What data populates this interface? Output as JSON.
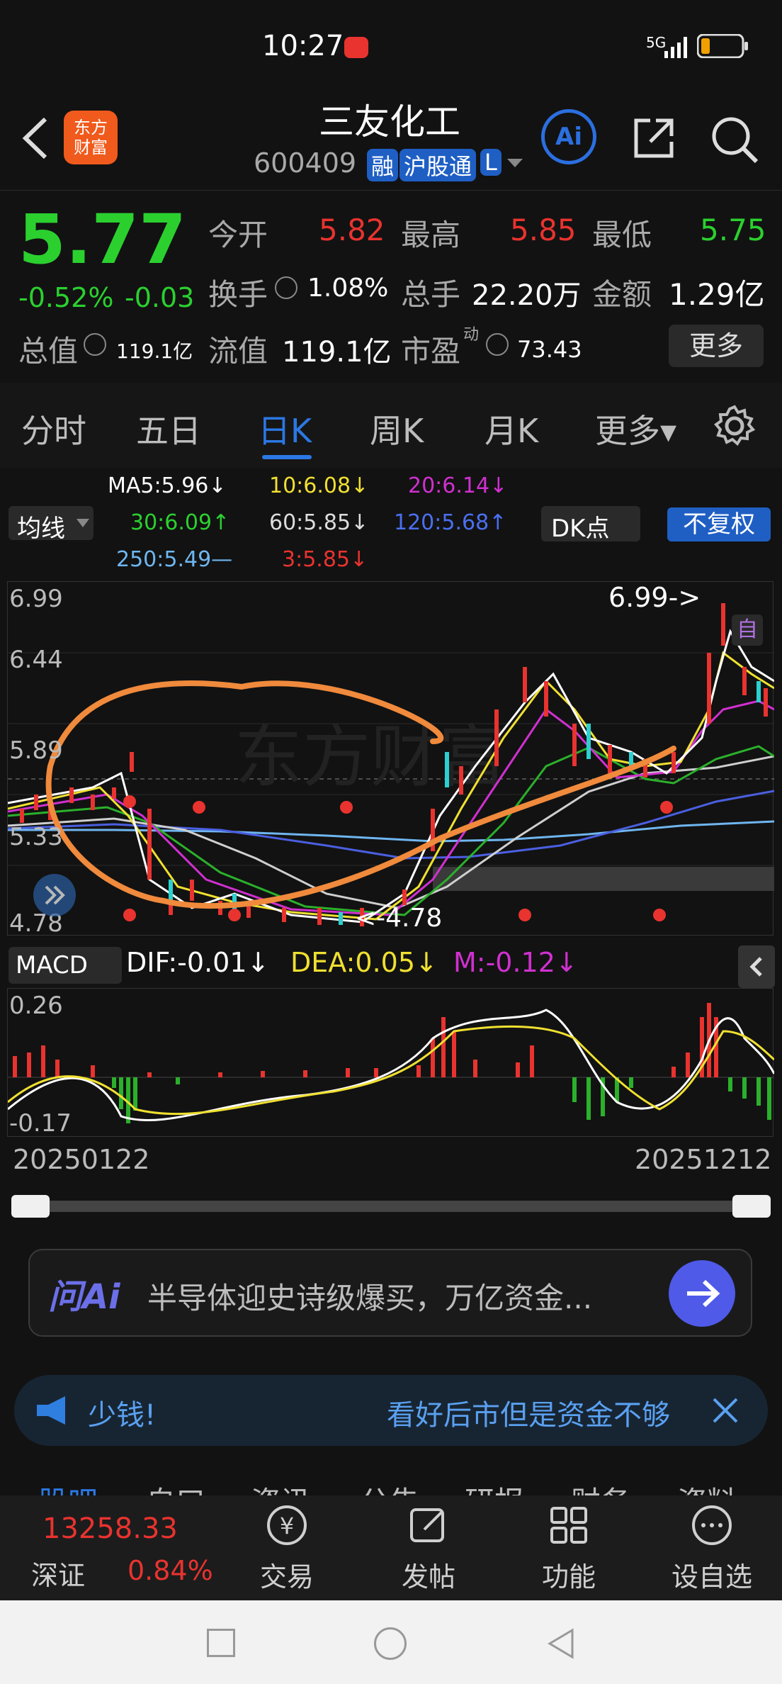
{
  "status_bar": {
    "time": "10:27",
    "signal": "5G"
  },
  "header": {
    "logo_text": "东方\n财富",
    "stock_name": "三友化工",
    "stock_code": "600409",
    "badge_rong": "融",
    "badge_hgt": "沪股通",
    "badge_l": "L",
    "ai_label": "Ai"
  },
  "quote": {
    "price": "5.77",
    "change_pct": "-0.52%",
    "change": "-0.03",
    "open_label": "今开",
    "open": "5.82",
    "high_label": "最高",
    "high": "5.85",
    "low_label": "最低",
    "low": "5.75",
    "turnover_label": "换手",
    "turnover": "1.08%",
    "volume_label": "总手",
    "volume": "22.20万",
    "amount_label": "金额",
    "amount": "1.29亿",
    "mktcap_label": "总值",
    "mktcap": "119.1亿",
    "float_label": "流值",
    "float": "119.1亿",
    "pe_label": "市盈",
    "pe_sup": "动",
    "pe": "73.43",
    "more_label": "更多"
  },
  "tabs": [
    {
      "label": "分时"
    },
    {
      "label": "五日"
    },
    {
      "label": "日K"
    },
    {
      "label": "周K"
    },
    {
      "label": "月K"
    },
    {
      "label": "更多▾"
    }
  ],
  "ma": {
    "selector_label": "均线",
    "ma5": "MA5:5.96↓",
    "ma10": "10:6.08↓",
    "ma20": "20:6.14↓",
    "ma30": "30:6.09↑",
    "ma60": "60:5.85↓",
    "ma120": "120:5.68↑",
    "ma250": "250:5.49—",
    "ma3": "3:5.85↓",
    "dk_label": "DK点",
    "fq_label": "不复权"
  },
  "price_chart": {
    "y_ticks": [
      "6.99",
      "6.44",
      "5.89",
      "5.33",
      "4.78"
    ],
    "high_note": "6.99->",
    "low_note": "<-4.78",
    "zi_label": "自",
    "colors": {
      "ma5": "#ffffff",
      "ma10": "#f0e030",
      "ma20": "#d030d0",
      "ma30": "#2bb02b",
      "ma60": "#cfcfcf",
      "ma120": "#4a5fe0",
      "ma250": "#6fb6f0",
      "annotation": "#f08a3c"
    }
  },
  "macd": {
    "label": "MACD",
    "dif": "DIF:-0.01↓",
    "dea": "DEA:0.05↓",
    "m": "M:-0.12↓",
    "y_ticks": [
      "0.26",
      "-0.17"
    ]
  },
  "dates": {
    "start": "20250122",
    "end": "20251212"
  },
  "ask_ai": {
    "brand": "问Ai",
    "placeholder": "半导体迎史诗级爆买，万亿资金..."
  },
  "notice": {
    "left": "少钱!",
    "right": "看好后市但是资金不够"
  },
  "bottom_tabs_partial": [
    "股吧",
    "自口",
    "资讯",
    "公告",
    "研报",
    "财务",
    "资料"
  ],
  "bottom_bar": {
    "index_value": "13258.33",
    "index_name": "深证",
    "index_change": "0.84%",
    "items": [
      {
        "label": "交易",
        "icon": "trade-icon"
      },
      {
        "label": "发帖",
        "icon": "post-icon"
      },
      {
        "label": "功能",
        "icon": "grid-icon"
      },
      {
        "label": "设自选",
        "icon": "more-icon"
      }
    ]
  }
}
